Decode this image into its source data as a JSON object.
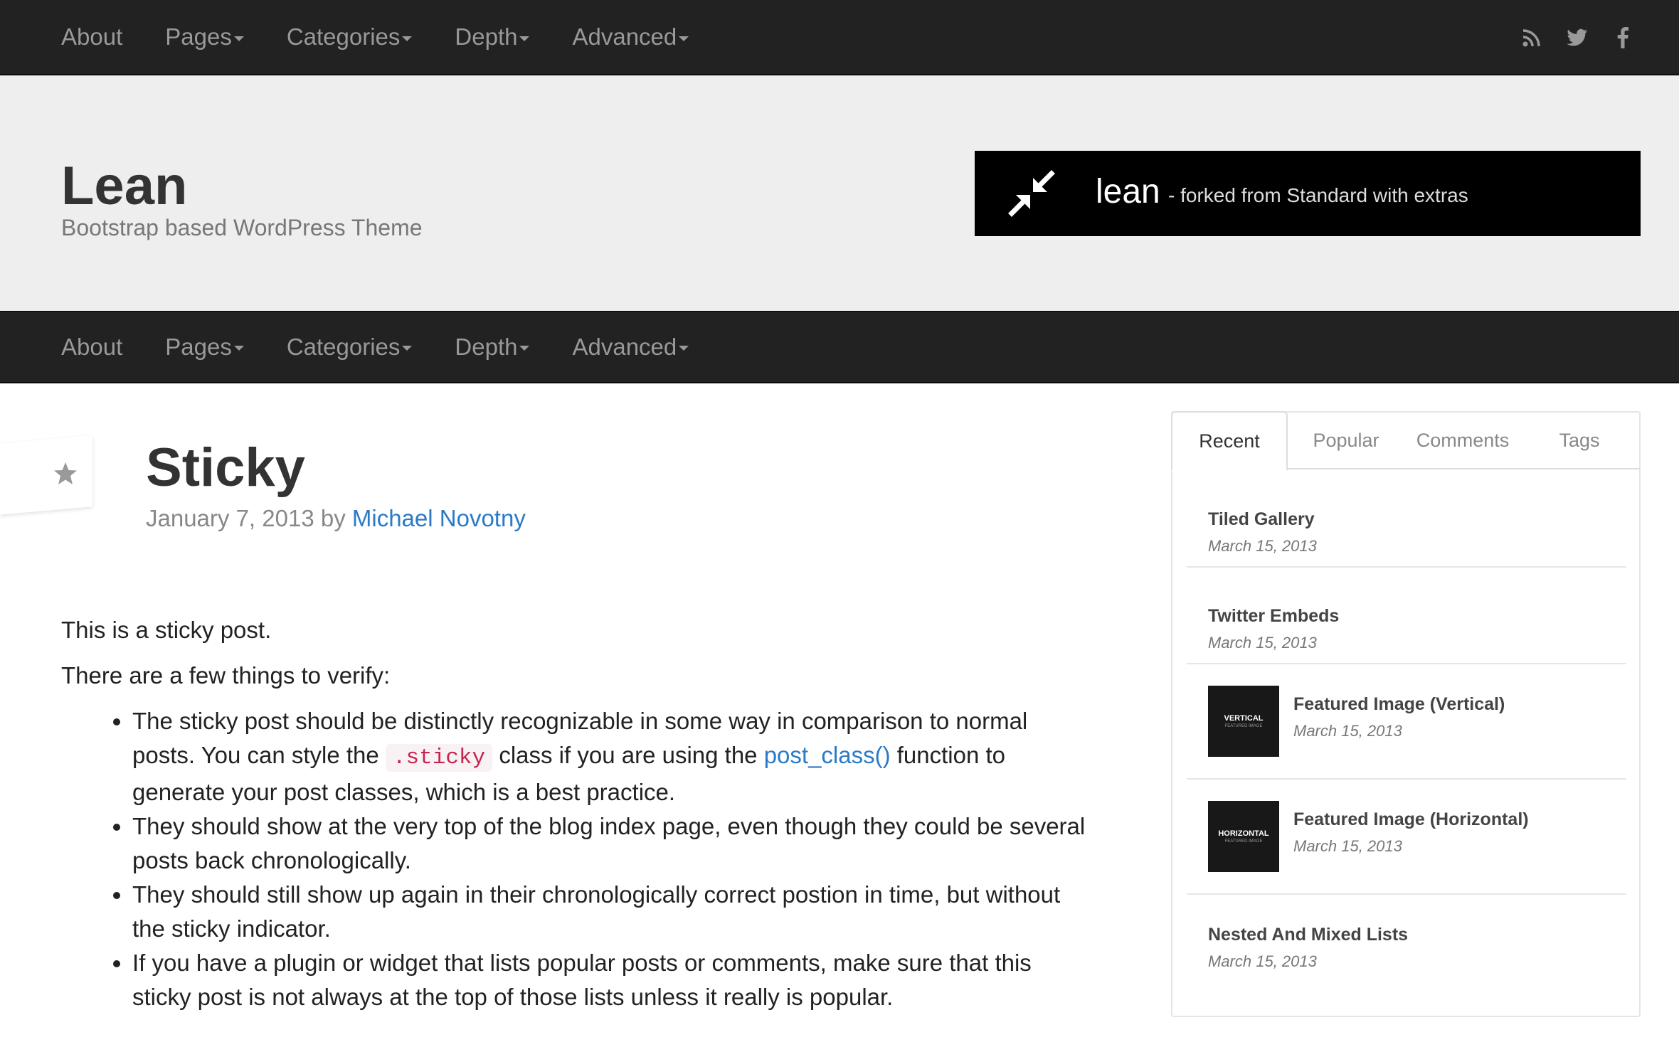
{
  "nav": {
    "items": [
      {
        "label": "About",
        "dropdown": false
      },
      {
        "label": "Pages",
        "dropdown": true
      },
      {
        "label": "Categories",
        "dropdown": true
      },
      {
        "label": "Depth",
        "dropdown": true
      },
      {
        "label": "Advanced",
        "dropdown": true
      }
    ],
    "social": [
      "rss-icon",
      "twitter-icon",
      "facebook-icon"
    ]
  },
  "header": {
    "title": "Lean",
    "description": "Bootstrap based WordPress Theme",
    "banner": {
      "name": "lean",
      "tagline": "- forked from Standard with extras"
    }
  },
  "post": {
    "title": "Sticky",
    "date": "January 7, 2013",
    "by": "by",
    "author": "Michael Novotny",
    "intro": "This is a sticky post.",
    "lead": "There are a few things to verify:",
    "bullet1_a": "The sticky post should be distinctly recognizable in some way in comparison to normal posts. You can style the",
    "bullet1_code": ".sticky",
    "bullet1_b": "class if you are using the",
    "bullet1_link": "post_class()",
    "bullet1_c": "function to generate your post classes, which is a best practice.",
    "bullet2": "They should show at the very top of the blog index page, even though they could be several posts back chronologically.",
    "bullet3": "They should still show up again in their chronologically correct postion in time, but without the sticky indicator.",
    "bullet4": "If you have a plugin or widget that lists popular posts or comments, make sure that this sticky post is not always at the top of those lists unless it really is popular."
  },
  "sidebar": {
    "tabs": [
      "Recent",
      "Popular",
      "Comments",
      "Tags"
    ],
    "active_tab": "Recent",
    "recent": [
      {
        "title": "Tiled Gallery",
        "date": "March 15, 2013"
      },
      {
        "title": "Twitter Embeds",
        "date": "March 15, 2013"
      },
      {
        "title": "Featured Image (Vertical)",
        "date": "March 15, 2013",
        "thumb": "VERTICAL",
        "thumb_sub": "FEATURED IMAGE"
      },
      {
        "title": "Featured Image (Horizontal)",
        "date": "March 15, 2013",
        "thumb": "HORIZONTAL",
        "thumb_sub": "FEATURED IMAGE"
      },
      {
        "title": "Nested And Mixed Lists",
        "date": "March 15, 2013"
      }
    ]
  }
}
